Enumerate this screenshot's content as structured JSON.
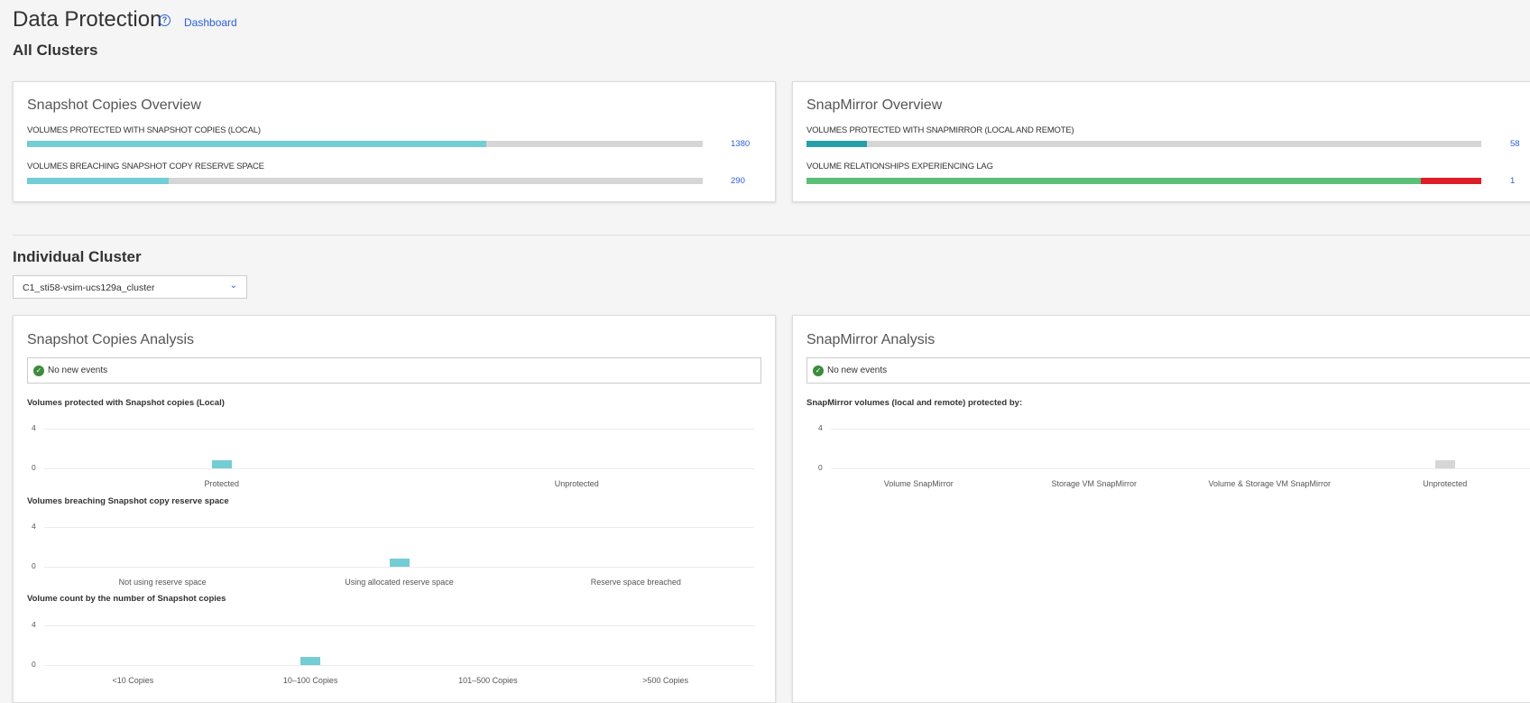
{
  "header": {
    "title": "Data Protection",
    "help_icon": "?",
    "dashboard_link": "Dashboard"
  },
  "all_clusters": {
    "heading": "All Clusters",
    "snapshot_overview": {
      "title": "Snapshot Copies Overview",
      "rows": [
        {
          "label": "VOLUMES PROTECTED WITH SNAPSHOT COPIES (LOCAL)",
          "value": "1380",
          "fill": 0.68,
          "color": "#74ccd4"
        },
        {
          "label": "VOLUMES BREACHING SNAPSHOT COPY RESERVE SPACE",
          "value": "290",
          "fill": 0.21,
          "color": "#74ccd4"
        }
      ]
    },
    "snapmirror_overview": {
      "title": "SnapMirror Overview",
      "rows": [
        {
          "label": "VOLUMES PROTECTED WITH SNAPMIRROR (LOCAL AND REMOTE)",
          "value": "58",
          "fill": 0.09,
          "color": "#26a0a8"
        },
        {
          "label": "VOLUME RELATIONSHIPS EXPERIENCING LAG",
          "value": "1",
          "fill": 0.91,
          "color": "#5bbf79",
          "rest_color": "#dd2027"
        }
      ]
    }
  },
  "individual": {
    "heading": "Individual Cluster",
    "cluster_select": "C1_sti58-vsim-ucs129a_cluster",
    "snapshot_analysis": {
      "title": "Snapshot Copies Analysis",
      "events": "No new events"
    },
    "snapmirror_analysis": {
      "title": "SnapMirror Analysis",
      "events": "No new events"
    }
  },
  "chart_data": [
    {
      "type": "bar",
      "title": "Volumes protected with Snapshot copies (Local)",
      "categories": [
        "Protected",
        "Unprotected"
      ],
      "values": [
        1,
        0
      ],
      "ylim": [
        0,
        4
      ],
      "yticks": [
        "0",
        "4"
      ],
      "color": "#74ccd4"
    },
    {
      "type": "bar",
      "title": "Volumes breaching Snapshot copy reserve space",
      "categories": [
        "Not using reserve space",
        "Using allocated reserve space",
        "Reserve space breached"
      ],
      "values": [
        0,
        1,
        0
      ],
      "ylim": [
        0,
        4
      ],
      "yticks": [
        "0",
        "4"
      ],
      "color": "#74ccd4"
    },
    {
      "type": "bar",
      "title": "Volume count by the number of Snapshot copies",
      "categories": [
        "<10 Copies",
        "10–100 Copies",
        "101–500 Copies",
        ">500 Copies"
      ],
      "values": [
        0,
        1,
        0,
        0
      ],
      "ylim": [
        0,
        4
      ],
      "yticks": [
        "0",
        "4"
      ],
      "color": "#74ccd4"
    },
    {
      "type": "bar",
      "title": "SnapMirror volumes (local and remote) protected by:",
      "categories": [
        "Volume SnapMirror",
        "Storage VM SnapMirror",
        "Volume & Storage VM SnapMirror",
        "Unprotected"
      ],
      "values": [
        0,
        0,
        0,
        1
      ],
      "ylim": [
        0,
        4
      ],
      "yticks": [
        "0",
        "4"
      ],
      "color": "#d6d6d6"
    }
  ]
}
